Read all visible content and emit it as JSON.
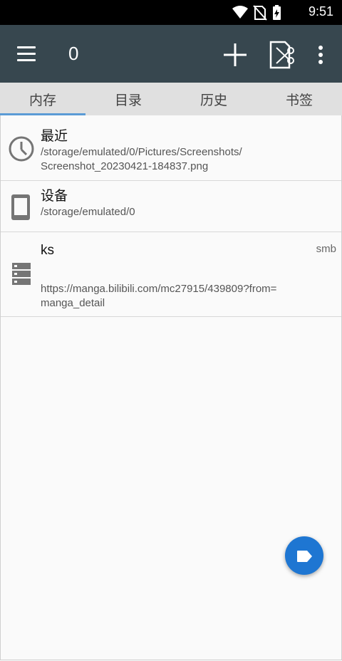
{
  "status_bar": {
    "time": "9:51"
  },
  "toolbar": {
    "title": "0"
  },
  "tabs": [
    {
      "label": "内存"
    },
    {
      "label": "目录"
    },
    {
      "label": "历史"
    },
    {
      "label": "书签"
    }
  ],
  "list": [
    {
      "name": "最近",
      "path": "/storage/emulated/0/Pictures/Screenshots/\nScreenshot_20230421-184837.png",
      "icon": "clock-icon"
    },
    {
      "name": "设备",
      "path": "/storage/emulated/0",
      "icon": "phone-icon"
    },
    {
      "name": "ks",
      "path": "https://manga.bilibili.com/mc27915/439809?from=\nmanga_detail",
      "tag": "smb",
      "icon": "server-icon"
    }
  ],
  "colors": {
    "toolbar": "#37474f",
    "tab_indicator": "#5b9bd5",
    "fab": "#1e76d2"
  }
}
